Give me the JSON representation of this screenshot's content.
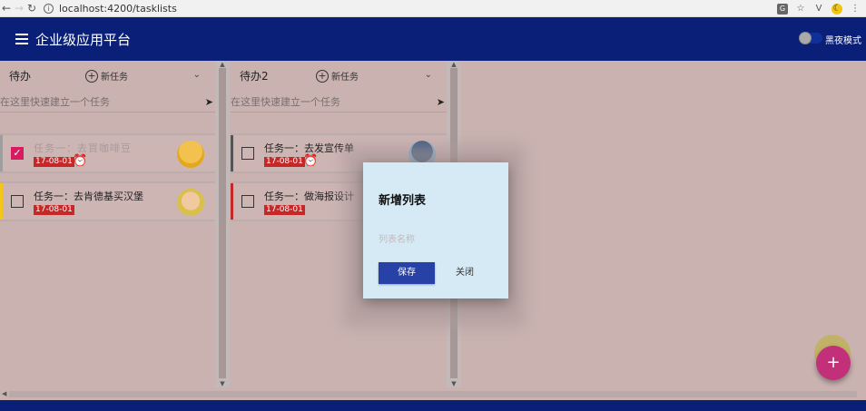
{
  "browser": {
    "url": "localhost:4200/tasklists"
  },
  "header": {
    "title": "企业级应用平台",
    "dark_mode_label": "黑夜模式"
  },
  "lists": [
    {
      "title": "待办",
      "new_task_label": "新任务",
      "quick_placeholder": "在这里快速建立一个任务",
      "tasks": [
        {
          "text": "任务一：去買咖啡豆",
          "date": "17-08-01",
          "checked": true,
          "has_reminder": true,
          "bar_color": "#9e9e9e"
        },
        {
          "text": "任务一：去肯德基买汉堡",
          "date": "17-08-01",
          "checked": false,
          "has_reminder": false,
          "bar_color": "#f5c518"
        }
      ]
    },
    {
      "title": "待办2",
      "new_task_label": "新任务",
      "quick_placeholder": "在这里快速建立一个任务",
      "tasks": [
        {
          "text": "任务一：去发宣传单",
          "date": "17-08-01",
          "checked": false,
          "has_reminder": true,
          "bar_color": "#555555"
        },
        {
          "text": "任务一：做海报设计",
          "date": "17-08-01",
          "checked": false,
          "has_reminder": false,
          "bar_color": "#c62828"
        }
      ]
    }
  ],
  "dialog": {
    "title": "新增列表",
    "input_placeholder": "列表名称",
    "save_label": "保存",
    "close_label": "关闭"
  },
  "colors": {
    "appbar": "#0a2078",
    "primary_button": "#2741a6",
    "fab": "#c2307a",
    "date_badge": "#c62828"
  }
}
